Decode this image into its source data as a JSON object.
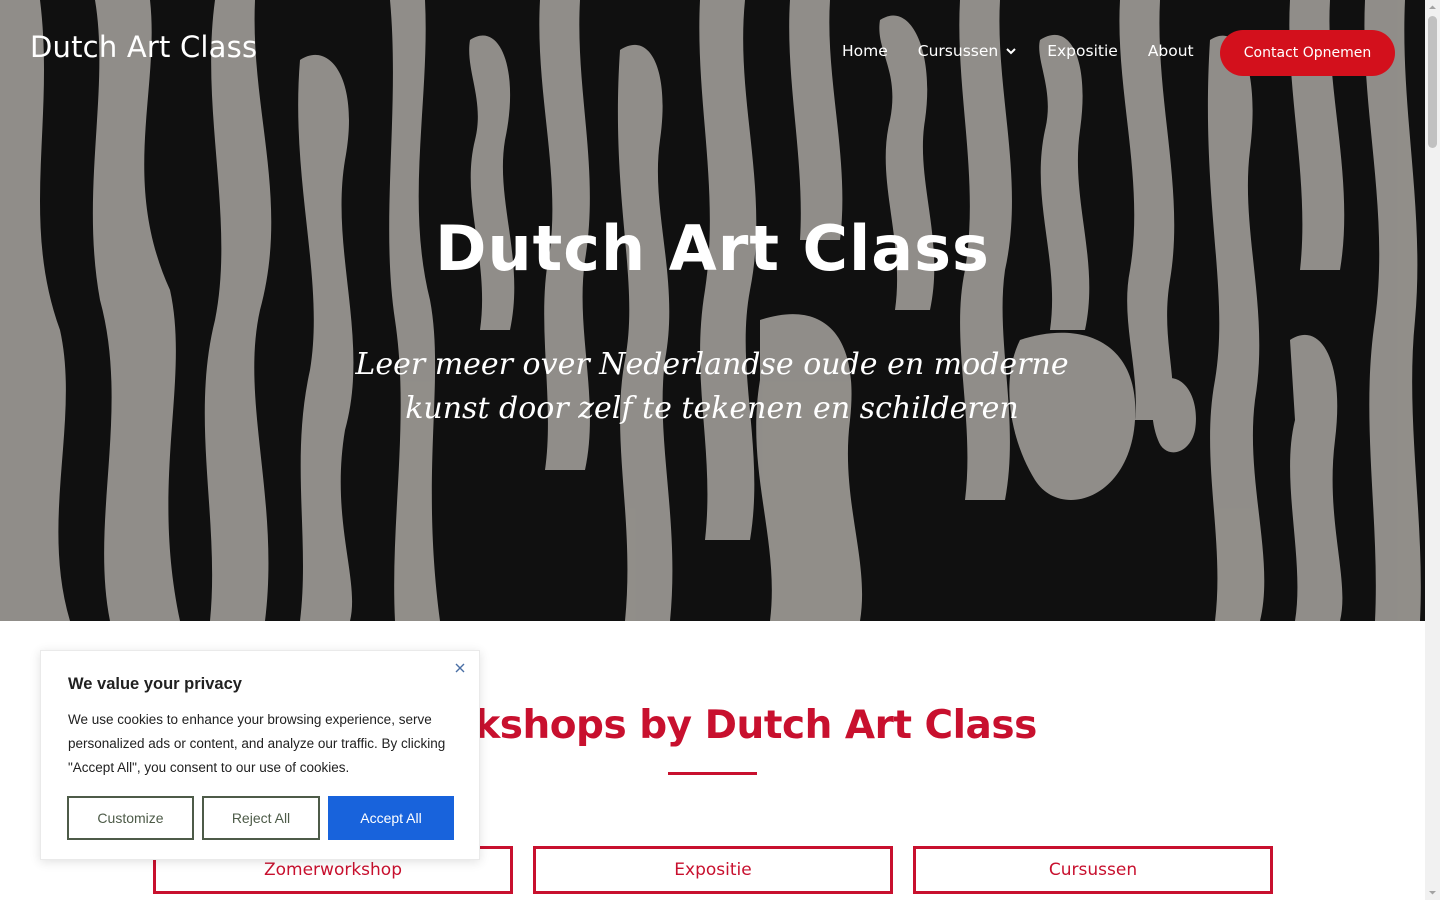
{
  "header": {
    "brand": "Dutch Art Class",
    "nav": [
      {
        "label": "Home"
      },
      {
        "label": "Cursussen",
        "has_dropdown": true
      },
      {
        "label": "Expositie"
      },
      {
        "label": "About"
      }
    ],
    "cta_label": "Contact Opnemen"
  },
  "hero": {
    "title": "Dutch Art Class",
    "subtitle": "Leer meer over Nederlandse oude en moderne kunst door zelf te tekenen en schilderen"
  },
  "main": {
    "section_title": "Workshops by Dutch Art Class",
    "cards": [
      {
        "label": "Zomerworkshop"
      },
      {
        "label": "Expositie"
      },
      {
        "label": "Cursussen"
      }
    ]
  },
  "cookie": {
    "title": "We value your privacy",
    "body": "We use cookies to enhance your browsing experience, serve personalized ads or content, and analyze our traffic. By clicking \"Accept All\", you consent to our use of cookies.",
    "customize": "Customize",
    "reject": "Reject All",
    "accept": "Accept All"
  },
  "colors": {
    "accent_red": "#c8102e",
    "cta_red": "#d3101c",
    "cookie_accept_blue": "#1863dc",
    "cookie_border_green": "#4d5b48"
  },
  "icons": {
    "dropdown": "chevron-down-icon",
    "close": "close-icon"
  }
}
